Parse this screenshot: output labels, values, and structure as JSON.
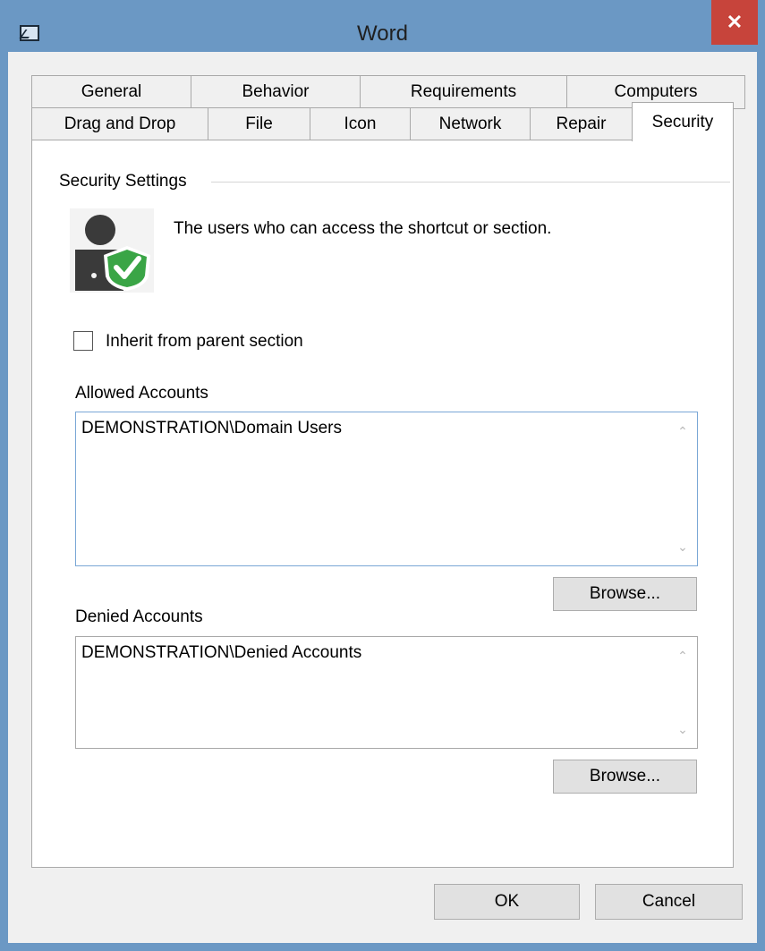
{
  "window": {
    "title": "Word",
    "close_glyph": "✕",
    "app_icon": "window-icon"
  },
  "tabs": {
    "row1": [
      "General",
      "Behavior",
      "Requirements",
      "Computers"
    ],
    "row2": [
      "Drag and Drop",
      "File",
      "Icon",
      "Network",
      "Repair",
      "Security"
    ],
    "active": "Security"
  },
  "security": {
    "section_title": "Security Settings",
    "icon": "user-shield-icon",
    "description": "The users who can access the shortcut or section.",
    "inherit_label": "Inherit from parent section",
    "inherit_checked": false,
    "allowed": {
      "label": "Allowed Accounts",
      "items": [
        "DEMONSTRATION\\Domain Users"
      ],
      "browse_label": "Browse..."
    },
    "denied": {
      "label": "Denied Accounts",
      "items": [
        "DEMONSTRATION\\Denied Accounts"
      ],
      "browse_label": "Browse..."
    }
  },
  "scroll": {
    "up": "⌃",
    "down": "⌄"
  },
  "footer": {
    "ok_label": "OK",
    "cancel_label": "Cancel"
  },
  "colors": {
    "titlebar": "#6b98c4",
    "close": "#c7443b",
    "shield": "#3aa546",
    "focus_border": "#7aa7d6"
  }
}
